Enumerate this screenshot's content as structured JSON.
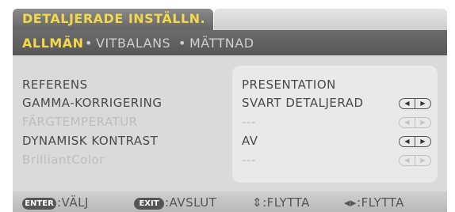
{
  "header": {
    "title": "DETALJERADE INSTÄLLN."
  },
  "tabs": {
    "active": "ALLMÄN",
    "separator": "•",
    "items": [
      "VITBALANS",
      "MÄTTNAD"
    ]
  },
  "settings": [
    {
      "label": "REFERENS",
      "value": "PRESENTATION",
      "enabled": true,
      "has_arrows": false
    },
    {
      "label": "GAMMA-KORRIGERING",
      "value": "SVART DETALJERAD",
      "enabled": true,
      "has_arrows": true
    },
    {
      "label": "FÄRGTEMPERATUR",
      "value": "---",
      "enabled": false,
      "has_arrows": true
    },
    {
      "label": "DYNAMISK KONTRAST",
      "value": "AV",
      "enabled": true,
      "has_arrows": true
    },
    {
      "label": "BrilliantColor",
      "value": "---",
      "enabled": false,
      "has_arrows": true
    }
  ],
  "arrows": {
    "left": "◀",
    "right": "▶"
  },
  "footer": {
    "enter_key": "ENTER",
    "enter_action": ":VÄLJ",
    "exit_key": "EXIT",
    "exit_action": ":AVSLUT",
    "move_ud": "⇕:FLYTTA",
    "move_lr": "◂▸:FLYTTA"
  },
  "colors": {
    "accent": "#f3d94a",
    "text": "#4a4a4a",
    "disabled": "#bdbdbd"
  }
}
